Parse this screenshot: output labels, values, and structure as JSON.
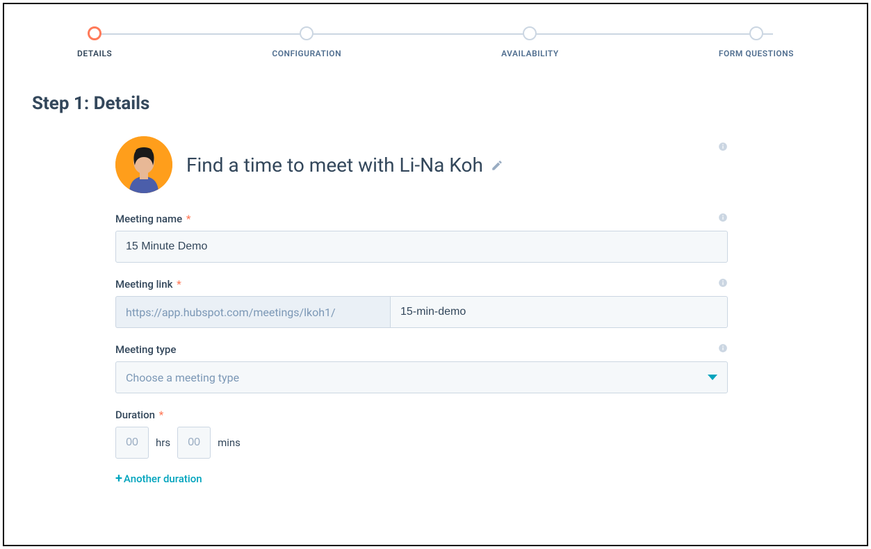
{
  "stepper": {
    "steps": [
      {
        "label": "DETAILS",
        "active": true
      },
      {
        "label": "CONFIGURATION",
        "active": false
      },
      {
        "label": "AVAILABILITY",
        "active": false
      },
      {
        "label": "FORM QUESTIONS",
        "active": false
      }
    ]
  },
  "page": {
    "title": "Step 1: Details",
    "headline": "Find a time to meet with Li-Na Koh"
  },
  "fields": {
    "meeting_name": {
      "label": "Meeting name",
      "value": "15 Minute Demo"
    },
    "meeting_link": {
      "label": "Meeting link",
      "prefix": "https://app.hubspot.com/meetings/lkoh1/",
      "value": "15-min-demo"
    },
    "meeting_type": {
      "label": "Meeting type",
      "placeholder": "Choose a meeting type"
    },
    "duration": {
      "label": "Duration",
      "hrs_value": "00",
      "hrs_unit": "hrs",
      "mins_value": "00",
      "mins_unit": "mins"
    },
    "add_duration": "Another duration"
  }
}
